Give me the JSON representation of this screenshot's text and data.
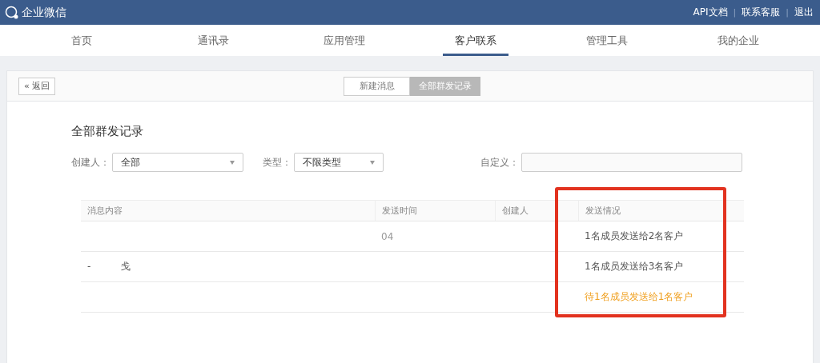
{
  "app": {
    "title": "企业微信",
    "links": [
      "API文档",
      "联系客服",
      "退出"
    ],
    "separator": "|"
  },
  "nav": [
    {
      "label": "首页",
      "selected": false
    },
    {
      "label": "通讯录",
      "selected": false
    },
    {
      "label": "应用管理",
      "selected": false
    },
    {
      "label": "客户联系",
      "selected": true
    },
    {
      "label": "管理工具",
      "selected": false
    },
    {
      "label": "我的企业",
      "selected": false
    }
  ],
  "back_button": {
    "arrow": "«",
    "label": "返回"
  },
  "view_toggle": [
    {
      "label": "新建消息",
      "selected": false
    },
    {
      "label": "全部群发记录",
      "selected": true
    }
  ],
  "heading": "全部群发记录",
  "filters": {
    "creator": {
      "label": "创建人：",
      "value": "全部"
    },
    "type": {
      "label": "类型：",
      "value": "不限类型"
    },
    "custom": {
      "label": "自定义："
    }
  },
  "table": {
    "columns": [
      "消息内容",
      "发送时间",
      "创建人",
      "发送情况"
    ],
    "rows": [
      {
        "content": "",
        "time": "04",
        "status": "1名成员发送给2名客户",
        "pending": false
      },
      {
        "content": "-          戋",
        "time": "",
        "status": "1名成员发送给3名客户",
        "pending": false
      },
      {
        "content": "",
        "time": "",
        "status": "待1名成员发送给1名客户",
        "pending": true
      }
    ]
  }
}
